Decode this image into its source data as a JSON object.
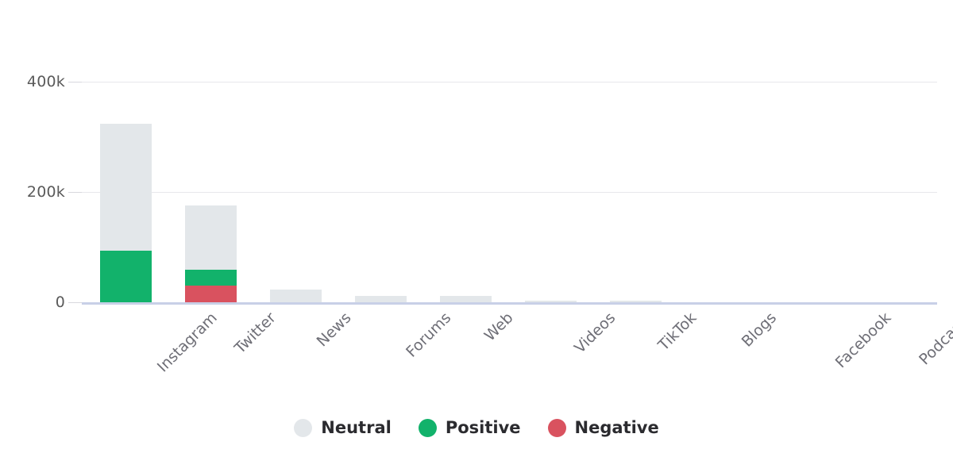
{
  "chart_data": {
    "type": "bar",
    "stacked": true,
    "title": "",
    "subtitle": "",
    "xlabel": "",
    "ylabel": "",
    "grid": true,
    "legend_position": "bottom",
    "categories": [
      "Instagram",
      "Twitter",
      "News",
      "Forums",
      "Web",
      "Videos",
      "TikTok",
      "Blogs",
      "Facebook",
      "Podcasts"
    ],
    "ylim": [
      0,
      440000
    ],
    "yticks": [
      0,
      200000,
      400000
    ],
    "ytick_labels": [
      "0",
      "200k",
      "400k"
    ],
    "series": [
      {
        "name": "Negative",
        "color": "#D9525F",
        "values": [
          0,
          30000,
          0,
          0,
          0,
          0,
          0,
          0,
          0,
          0
        ]
      },
      {
        "name": "Positive",
        "color": "#12B26B",
        "values": [
          93000,
          29000,
          0,
          0,
          0,
          0,
          0,
          0,
          0,
          0
        ]
      },
      {
        "name": "Neutral",
        "color": "#E3E7EA",
        "values": [
          231000,
          117000,
          23000,
          12000,
          12000,
          2500,
          2500,
          0,
          0,
          0
        ]
      }
    ],
    "totals": [
      324000,
      176000,
      23000,
      12000,
      12000,
      2500,
      2500,
      0,
      0,
      0
    ]
  },
  "legend": {
    "items": [
      {
        "label": "Neutral",
        "color": "#E3E7EA"
      },
      {
        "label": "Positive",
        "color": "#12B26B"
      },
      {
        "label": "Negative",
        "color": "#D9525F"
      }
    ]
  },
  "colors": {
    "neutral": "#E3E7EA",
    "positive": "#12B26B",
    "negative": "#D9525F",
    "gridline": "#E8E8EC",
    "axis": "#C8D0E7",
    "tick_text": "#5A5A5A",
    "category_text": "#6E6E76",
    "legend_text": "#2B2B2F",
    "background": "#FFFFFF"
  }
}
